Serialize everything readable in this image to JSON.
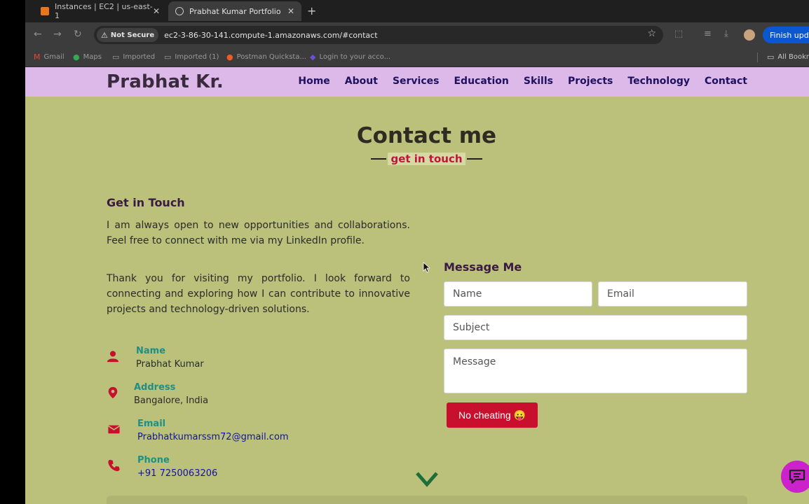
{
  "browser": {
    "tabs": [
      {
        "title": "Instances | EC2 | us-east-1",
        "icon": "aws-icon",
        "active": false
      },
      {
        "title": "Prabhat Kumar Portfolio",
        "icon": "globe-icon",
        "active": true
      }
    ],
    "security_label": "Not Secure",
    "url": "ec2-3-86-30-141.compute-1.amazonaws.com/#contact",
    "update_button": "Finish update",
    "bookmarks": [
      "Gmail",
      "Maps",
      "Imported",
      "Imported (1)",
      "Postman Quicksta...",
      "Login to your acco...",
      "All Bookmarks"
    ]
  },
  "site": {
    "logo": "Prabhat Kr.",
    "nav": [
      "Home",
      "About",
      "Services",
      "Education",
      "Skills",
      "Projects",
      "Technology",
      "Contact"
    ]
  },
  "contact": {
    "title": "Contact me",
    "subtitle": "get in touch",
    "get_in_touch_title": "Get in Touch",
    "para1": "I am always open to new opportunities and collaborations. Feel free to connect with me via my LinkedIn profile.",
    "para2": "Thank you for visiting my portfolio. I look forward to connecting and exploring how I can contribute to innovative projects and technology-driven solutions.",
    "info": [
      {
        "label": "Name",
        "value": "Prabhat Kumar",
        "icon": "user-icon"
      },
      {
        "label": "Address",
        "value": "Bangalore, India",
        "icon": "map-pin-icon"
      },
      {
        "label": "Email",
        "value": "Prabhatkumarssm72@gmail.com",
        "icon": "envelope-icon"
      },
      {
        "label": "Phone",
        "value": "+91 7250063206",
        "icon": "phone-icon"
      }
    ],
    "form": {
      "title": "Message Me",
      "name_placeholder": "Name",
      "email_placeholder": "Email",
      "subject_placeholder": "Subject",
      "message_placeholder": "Message",
      "submit_label": "No cheating 😛"
    }
  },
  "colors": {
    "page_bg": "#bbc07a",
    "nav_bg": "#dcb9e8",
    "accent_red": "#c8102e",
    "teal_label": "#1f8f86",
    "chat_bubble": "#cc22cc"
  }
}
